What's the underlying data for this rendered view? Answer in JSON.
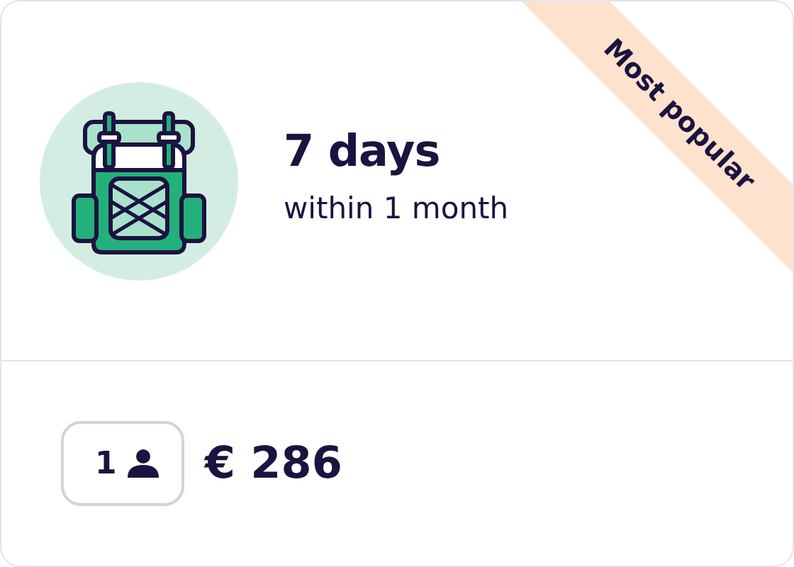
{
  "plan": {
    "duration": "7 days",
    "window": "within 1 month",
    "badge": "Most popular"
  },
  "footer": {
    "travelers": "1",
    "price": "€ 286"
  }
}
